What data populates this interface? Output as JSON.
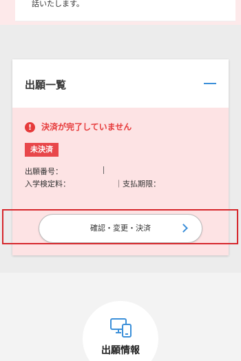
{
  "notice": {
    "text": "話いたします。"
  },
  "card": {
    "title": "出願一覧",
    "alert_text": "決済が完了していません",
    "status_badge": "未決済",
    "application_number_label": "出願番号：",
    "exam_fee_label": "入学検定料：",
    "payment_deadline_label": "｜支払期限：",
    "action_label": "確認・変更・決済"
  },
  "section": {
    "title": "出願情報"
  },
  "colors": {
    "accent_blue": "#3b8fd9",
    "alert_red": "#e63a3a",
    "badge_red": "#e8474b",
    "card_pink": "#fde3e4",
    "highlight_red": "#d6262b"
  },
  "icons": [
    "alert-icon",
    "collapse-icon",
    "chevron-right-icon",
    "device-icon"
  ]
}
